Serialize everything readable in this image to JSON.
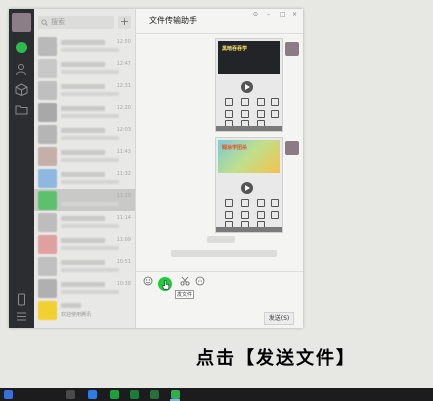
{
  "search": {
    "placeholder": "搜索"
  },
  "add_button": "+",
  "conversations": [
    {
      "time": "12:50",
      "color": "#b9b9b9"
    },
    {
      "time": "12:47",
      "color": "#c8c8c8"
    },
    {
      "time": "12:31",
      "color": "#bfbfbf"
    },
    {
      "time": "12:20",
      "color": "#a8a8a8"
    },
    {
      "time": "12:03",
      "color": "#b5b5b5"
    },
    {
      "time": "11:43",
      "color": "#c4b0a8"
    },
    {
      "time": "11:32",
      "color": "#8fb8e0"
    },
    {
      "time": "11:20",
      "color": "#5cc06c"
    },
    {
      "time": "11:14",
      "color": "#bdbdbd"
    },
    {
      "time": "11:09",
      "color": "#e0a0a0"
    },
    {
      "time": "10:51",
      "color": "#c0c0c0"
    },
    {
      "time": "10:38",
      "color": "#b0b0b0"
    },
    {
      "name": "",
      "preview": "欢迎使用腾讯",
      "time": "",
      "color": "#f2d030"
    }
  ],
  "chat": {
    "title": "文件传输助手",
    "window_controls": [
      "⊙",
      "–",
      "□",
      "×"
    ],
    "shot1_banner": "黑暗吞吞学",
    "shot2_banner": "糊涂学团杀",
    "system_line1": "",
    "system_line2": "",
    "tooltip": "发文件",
    "send_label": "发送(S)"
  },
  "caption": "点击【发送文件】",
  "colors": {
    "accent_green": "#1fcc3c",
    "rail": "#2c2d31"
  },
  "icons": [
    "chat-icon",
    "contacts-icon",
    "cube-icon",
    "folder-icon",
    "phone-icon",
    "menu-icon",
    "emoji-icon",
    "folder-send-icon",
    "scissors-icon",
    "bubble-icon"
  ]
}
